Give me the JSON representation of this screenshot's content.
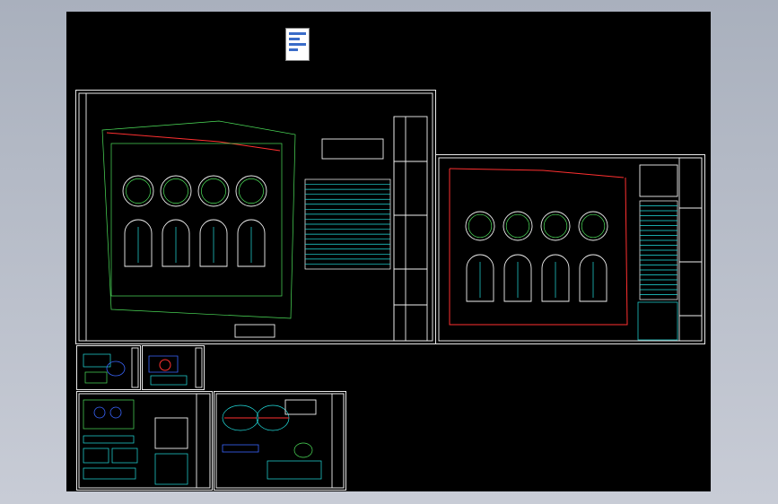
{
  "colors": {
    "background": "#b5bbc7",
    "viewport": "#000000",
    "cyan": "#22e0e0",
    "green": "#4de05a",
    "red": "#ff3030",
    "blue": "#3a66ff",
    "white": "#f0f0f0"
  },
  "icons": {
    "layout_thumbnail": "page-thumbnail-icon"
  },
  "sheets": [
    {
      "id": "site-plan-main",
      "tanks": 4,
      "basins": 4
    },
    {
      "id": "site-plan-secondary",
      "tanks": 4,
      "basins": 4
    },
    {
      "id": "detail-sheet-small-1"
    },
    {
      "id": "detail-sheet-small-2"
    },
    {
      "id": "detail-sheet-3"
    },
    {
      "id": "detail-sheet-4"
    }
  ]
}
